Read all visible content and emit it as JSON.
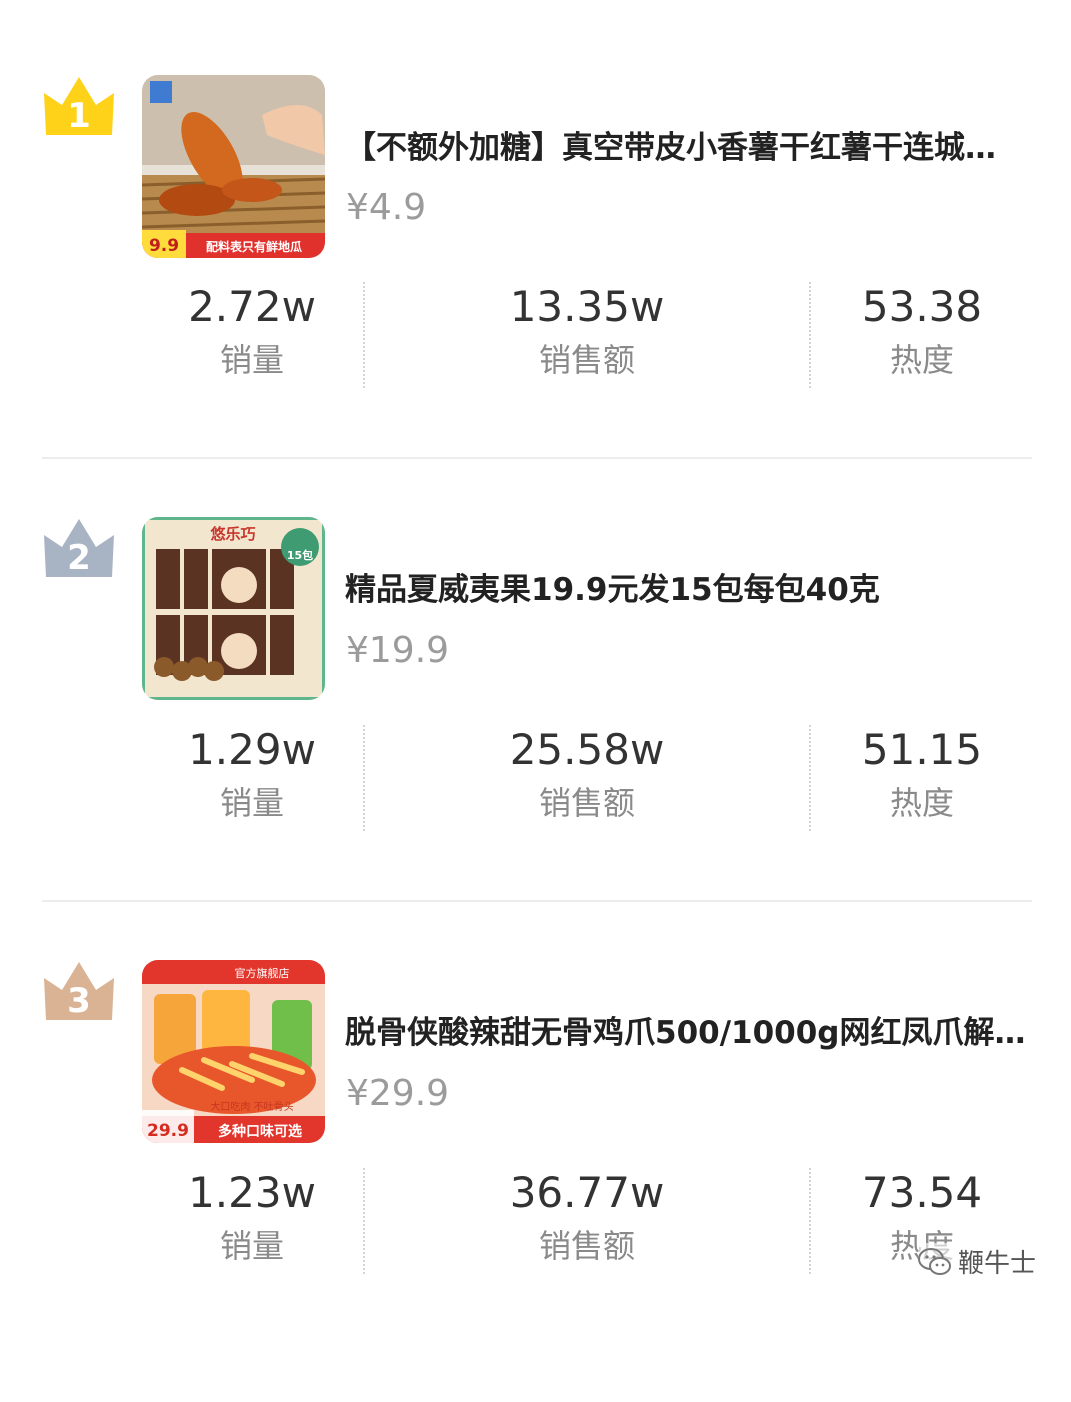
{
  "colors": {
    "gold": "#FFD21A",
    "silver": "#A8B3C4",
    "bronze": "#D9B394"
  },
  "products": [
    {
      "rank": "1",
      "title": "【不额外加糖】真空带皮小香薯干红薯干连城…",
      "price": "¥4.9",
      "thumb_text": {
        "price_tag": "9.9",
        "banner": "配料表只有鲜地瓜"
      },
      "stats": {
        "sales": "2.72w",
        "sales_label": "销量",
        "revenue": "13.35w",
        "revenue_label": "销售额",
        "heat": "53.38",
        "heat_label": "热度"
      }
    },
    {
      "rank": "2",
      "title": "精品夏威夷果19.9元发15包每包40克",
      "price": "¥19.9",
      "thumb_text": {
        "brand": "悠乐巧",
        "badge": "15包"
      },
      "stats": {
        "sales": "1.29w",
        "sales_label": "销量",
        "revenue": "25.58w",
        "revenue_label": "销售额",
        "heat": "51.15",
        "heat_label": "热度"
      }
    },
    {
      "rank": "3",
      "title": "脱骨侠酸辣甜无骨鸡爪500/1000g网红凤爪解…",
      "price": "¥29.9",
      "thumb_text": {
        "store": "官方旗舰店",
        "price_tag": "29.9",
        "banner": "多种口味可选",
        "sub": "大口吃肉 不吐骨头"
      },
      "stats": {
        "sales": "1.23w",
        "sales_label": "销量",
        "revenue": "36.77w",
        "revenue_label": "销售额",
        "heat": "73.54",
        "heat_label": "热度"
      }
    }
  ],
  "watermark": {
    "text": "鞭牛士",
    "icon": "wechat-icon"
  }
}
